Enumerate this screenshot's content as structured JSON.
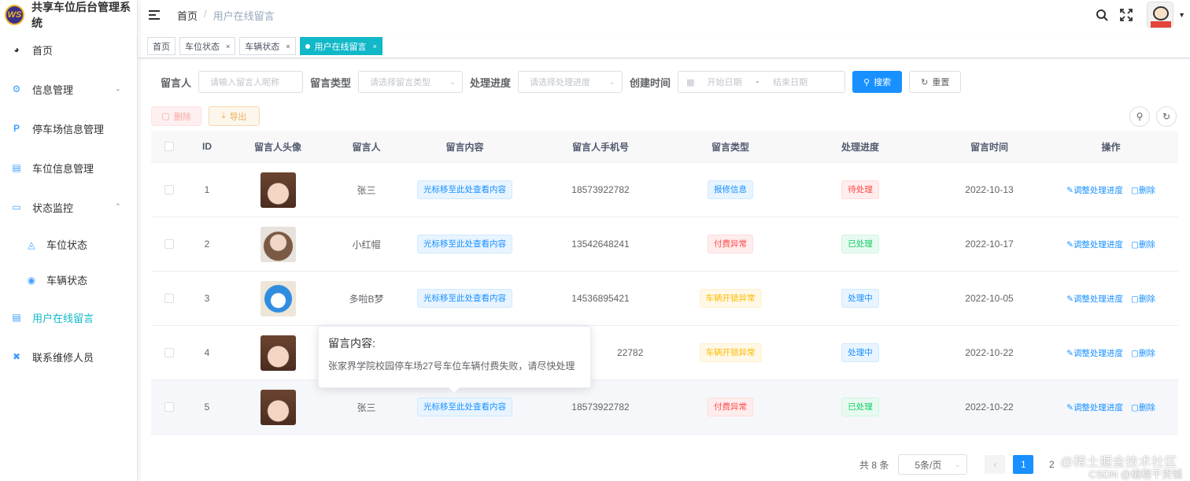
{
  "app": {
    "title": "共享车位后台管理系统",
    "logo_text": "WS"
  },
  "sidebar": {
    "items": [
      {
        "label": "首页",
        "icon": "dashboard-icon"
      },
      {
        "label": "信息管理",
        "icon": "settings-icon"
      },
      {
        "label": "停车场信息管理",
        "icon": "parking-icon"
      },
      {
        "label": "车位信息管理",
        "icon": "document-icon"
      },
      {
        "label": "状态监控",
        "icon": "monitor-icon"
      },
      {
        "label": "车位状态",
        "icon": "slot-icon"
      },
      {
        "label": "车辆状态",
        "icon": "vehicle-icon"
      },
      {
        "label": "用户在线留言",
        "icon": "message-icon"
      },
      {
        "label": "联系维修人员",
        "icon": "tools-icon"
      }
    ]
  },
  "header": {
    "breadcrumb": [
      "首页",
      "用户在线留言"
    ]
  },
  "tags": [
    {
      "label": "首页"
    },
    {
      "label": "车位状态"
    },
    {
      "label": "车辆状态"
    },
    {
      "label": "用户在线留言"
    }
  ],
  "search": {
    "author_label": "留言人",
    "author_placeholder": "请输入留言人昵称",
    "type_label": "留言类型",
    "type_placeholder": "请选择留言类型",
    "progress_label": "处理进度",
    "progress_placeholder": "请选择处理进度",
    "time_label": "创建时间",
    "start_placeholder": "开始日期",
    "range_sep": "-",
    "end_placeholder": "结束日期",
    "search_btn": "搜索",
    "reset_btn": "重置"
  },
  "toolbar": {
    "delete_btn": "删除",
    "export_btn": "导出"
  },
  "table": {
    "columns": [
      "ID",
      "留言人头像",
      "留言人",
      "留言内容",
      "留言人手机号",
      "留言类型",
      "处理进度",
      "留言时间",
      "操作"
    ],
    "rows": [
      {
        "id": "1",
        "name": "张三",
        "content": "光标移至此处查看内容",
        "phone": "18573922782",
        "type": "报修信息",
        "type_color": "blue",
        "progress": "待处理",
        "progress_color": "red",
        "time": "2022-10-13"
      },
      {
        "id": "2",
        "name": "小红帽",
        "content": "光标移至此处查看内容",
        "phone": "13542648241",
        "type": "付费异常",
        "type_color": "red",
        "progress": "已处理",
        "progress_color": "green",
        "time": "2022-10-17"
      },
      {
        "id": "3",
        "name": "多啦B梦",
        "content": "光标移至此处查看内容",
        "phone": "14536895421",
        "type": "车辆开锁异常",
        "type_color": "yellow",
        "progress": "处理中",
        "progress_color": "blue",
        "time": "2022-10-05"
      },
      {
        "id": "4",
        "name": "",
        "content": "",
        "phone": "22782",
        "type": "车辆开锁异常",
        "type_color": "yellow",
        "progress": "处理中",
        "progress_color": "blue",
        "time": "2022-10-22"
      },
      {
        "id": "5",
        "name": "张三",
        "content": "光标移至此处查看内容",
        "phone": "18573922782",
        "type": "付费异常",
        "type_color": "red",
        "progress": "已处理",
        "progress_color": "green",
        "time": "2022-10-22"
      }
    ],
    "op_edit": "调整处理进度",
    "op_delete": "删除"
  },
  "tooltip": {
    "title": "留言内容:",
    "body": "张家界学院校园停车场27号车位车辆付费失败，请尽快处理"
  },
  "pagination": {
    "total": "共 8 条",
    "page_size": "5条/页",
    "pages": [
      "1",
      "2"
    ],
    "current": "1"
  },
  "watermark": {
    "line1": "@稀土掘金技术社区",
    "line2": "CSDN @编程干货铺"
  },
  "colors": {
    "accent": "#11b8c8",
    "primary": "#1890ff"
  }
}
